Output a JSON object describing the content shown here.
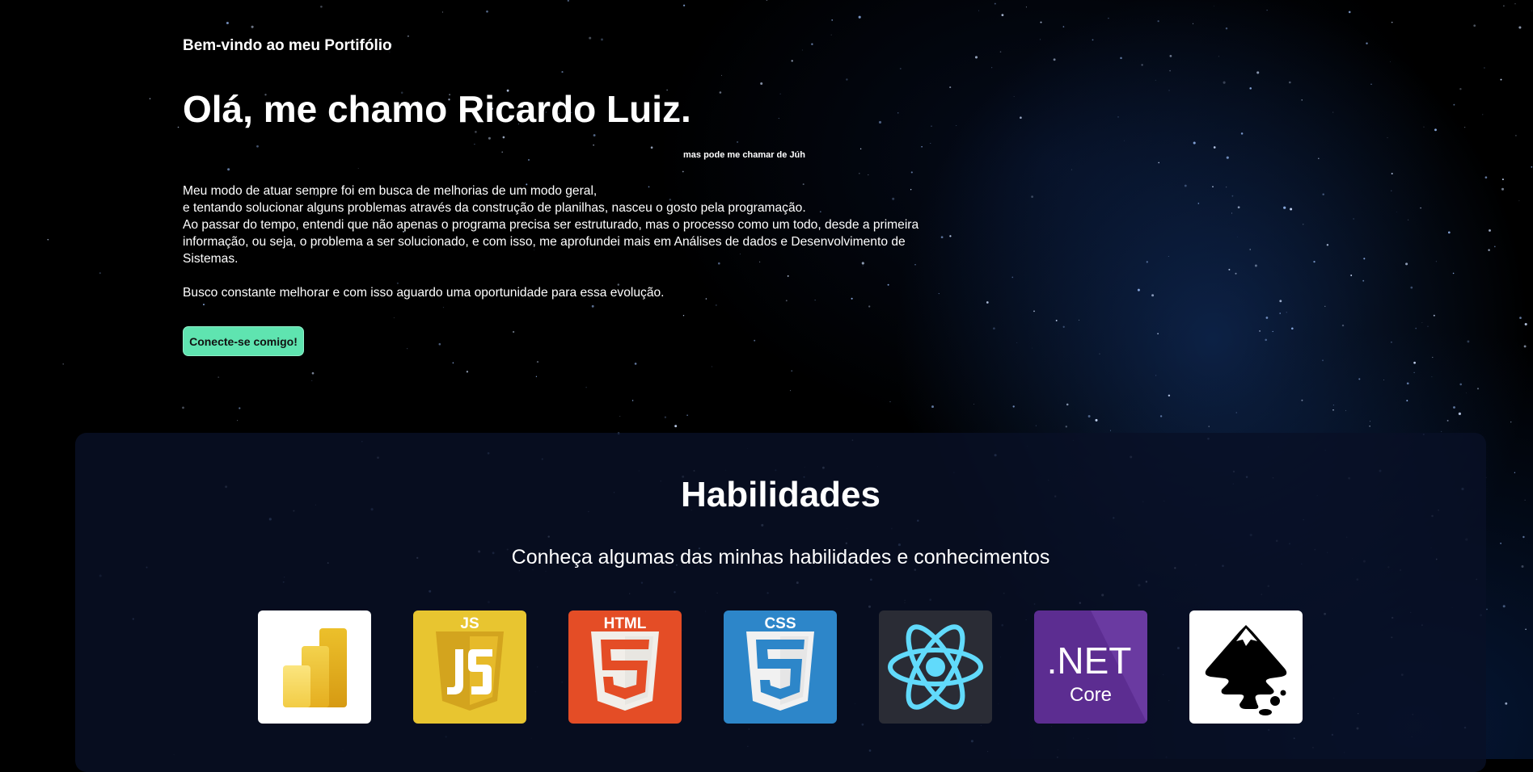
{
  "hero": {
    "tagline": "Bem-vindo ao meu Portifólio",
    "title": "Olá, me chamo Ricardo Luiz.",
    "subtitle": "mas pode me chamar de Júh",
    "bio_lines": [
      "Meu modo de atuar sempre foi em busca de melhorias de um modo geral,",
      "e tentando solucionar alguns problemas através da construção de planilhas, nasceu o gosto pela programação.",
      "Ao passar do tempo, entendi que não apenas o programa precisa ser estruturado, mas o processo como um todo, desde a primeira informação, ou seja, o problema a ser solucionado, e com isso, me aprofundei mais em Análises de dados e Desenvolvimento de Sistemas."
    ],
    "bio_closing": "Busco constante melhorar e com isso aguardo uma oportunidade para essa evolução.",
    "cta_label": "Conecte-se comigo!"
  },
  "skills": {
    "title": "Habilidades",
    "description": "Conheça algumas das minhas habilidades e conhecimentos",
    "items": [
      {
        "icon": "powerbi-icon",
        "bg": "#ffffff"
      },
      {
        "icon": "javascript-icon",
        "bg": "#e8c530",
        "label": "JS"
      },
      {
        "icon": "html5-icon",
        "bg": "#e44d26",
        "label": "HTML"
      },
      {
        "icon": "css3-icon",
        "bg": "#2d86c9",
        "label": "CSS"
      },
      {
        "icon": "react-icon",
        "bg": "#2a2c35"
      },
      {
        "icon": "dotnet-core-icon",
        "bg": "#5c2d91",
        "label": ".NET",
        "sublabel": "Core"
      },
      {
        "icon": "inkscape-icon",
        "bg": "#ffffff"
      }
    ]
  },
  "colors": {
    "cta_bg": "#5fe4b0",
    "panel_bg": "#081026"
  }
}
